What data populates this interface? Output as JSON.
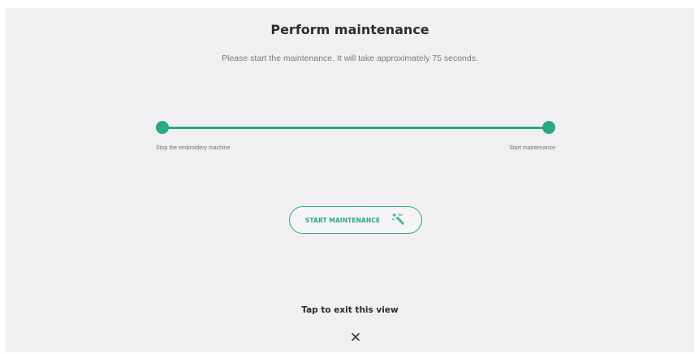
{
  "dialog": {
    "title": "Perform maintenance",
    "subtitle": "Please start the maintenance. It will take approximately 75 seconds."
  },
  "stepper": {
    "steps": [
      {
        "label": "Stop the embroidery machine"
      },
      {
        "label": "Start maintenance"
      }
    ],
    "progress": 1.0
  },
  "actions": {
    "start_label": "START MAINTENANCE",
    "start_icon": "magic-wand-icon"
  },
  "exit": {
    "label": "Tap to exit this view",
    "icon": "close-icon"
  },
  "colors": {
    "accent": "#29a884",
    "background": "#f0eff2",
    "text": "#2e2e2e",
    "muted_text": "#7b7b7f"
  }
}
